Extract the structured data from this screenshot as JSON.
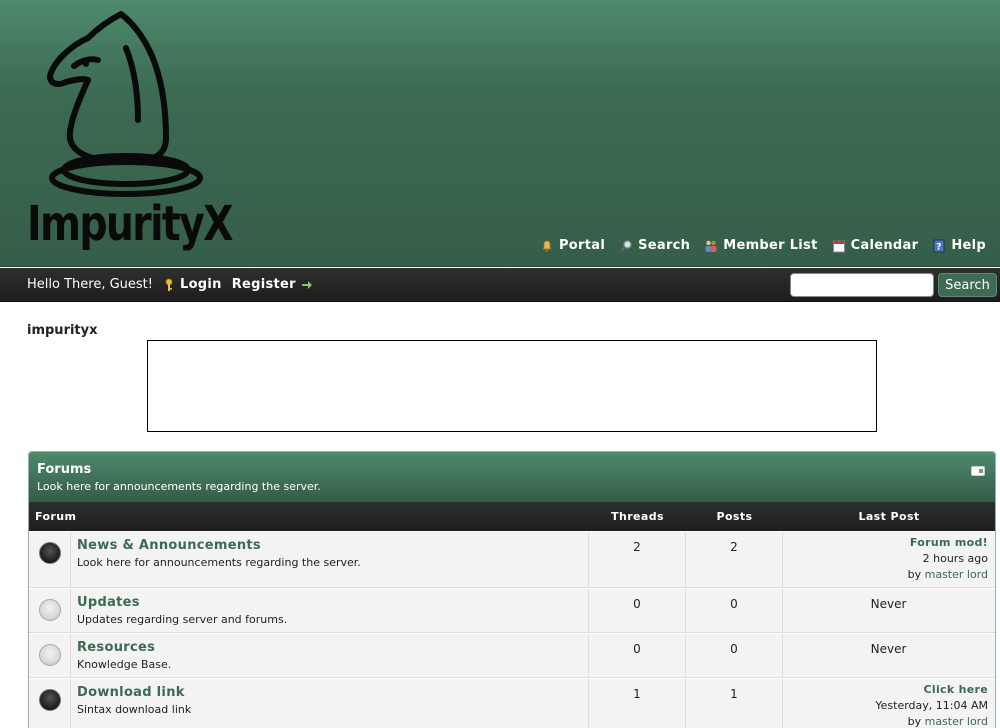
{
  "site": {
    "logo_text": "ImpurityX",
    "name": "impurityx"
  },
  "topnav": [
    {
      "label": "Portal",
      "icon": "bell-icon"
    },
    {
      "label": "Search",
      "icon": "magnifier-icon"
    },
    {
      "label": "Member List",
      "icon": "members-icon"
    },
    {
      "label": "Calendar",
      "icon": "calendar-icon"
    },
    {
      "label": "Help",
      "icon": "help-icon"
    }
  ],
  "panel": {
    "greeting": "Hello There, Guest!",
    "login_label": "Login",
    "register_label": "Register",
    "search_button": "Search",
    "search_value": ""
  },
  "category": {
    "title": "Forums",
    "description": "Look here for announcements regarding the server."
  },
  "columns": {
    "forum": "Forum",
    "threads": "Threads",
    "posts": "Posts",
    "last_post": "Last Post"
  },
  "forums": [
    {
      "name": "News & Announcements",
      "description": "Look here for announcements regarding the server.",
      "threads": "2",
      "posts": "2",
      "status": "on",
      "last_post": {
        "title": "Forum mod!",
        "time": "2 hours ago",
        "by": "by",
        "user": "master lord"
      }
    },
    {
      "name": "Updates",
      "description": "Updates regarding server and forums.",
      "threads": "0",
      "posts": "0",
      "status": "off",
      "last_post_text": "Never"
    },
    {
      "name": "Resources",
      "description": "Knowledge Base.",
      "threads": "0",
      "posts": "0",
      "status": "off",
      "last_post_text": "Never"
    },
    {
      "name": "Download link",
      "description": "Sintax download link",
      "threads": "1",
      "posts": "1",
      "status": "on",
      "last_post": {
        "title": "Click here",
        "time": "Yesterday, 11:04 AM",
        "by": "by",
        "user": "master lord"
      }
    }
  ],
  "colors": {
    "header_green": "#3c6a52",
    "link_green": "#3c6a52",
    "panel_dark": "#1e1e1e"
  }
}
